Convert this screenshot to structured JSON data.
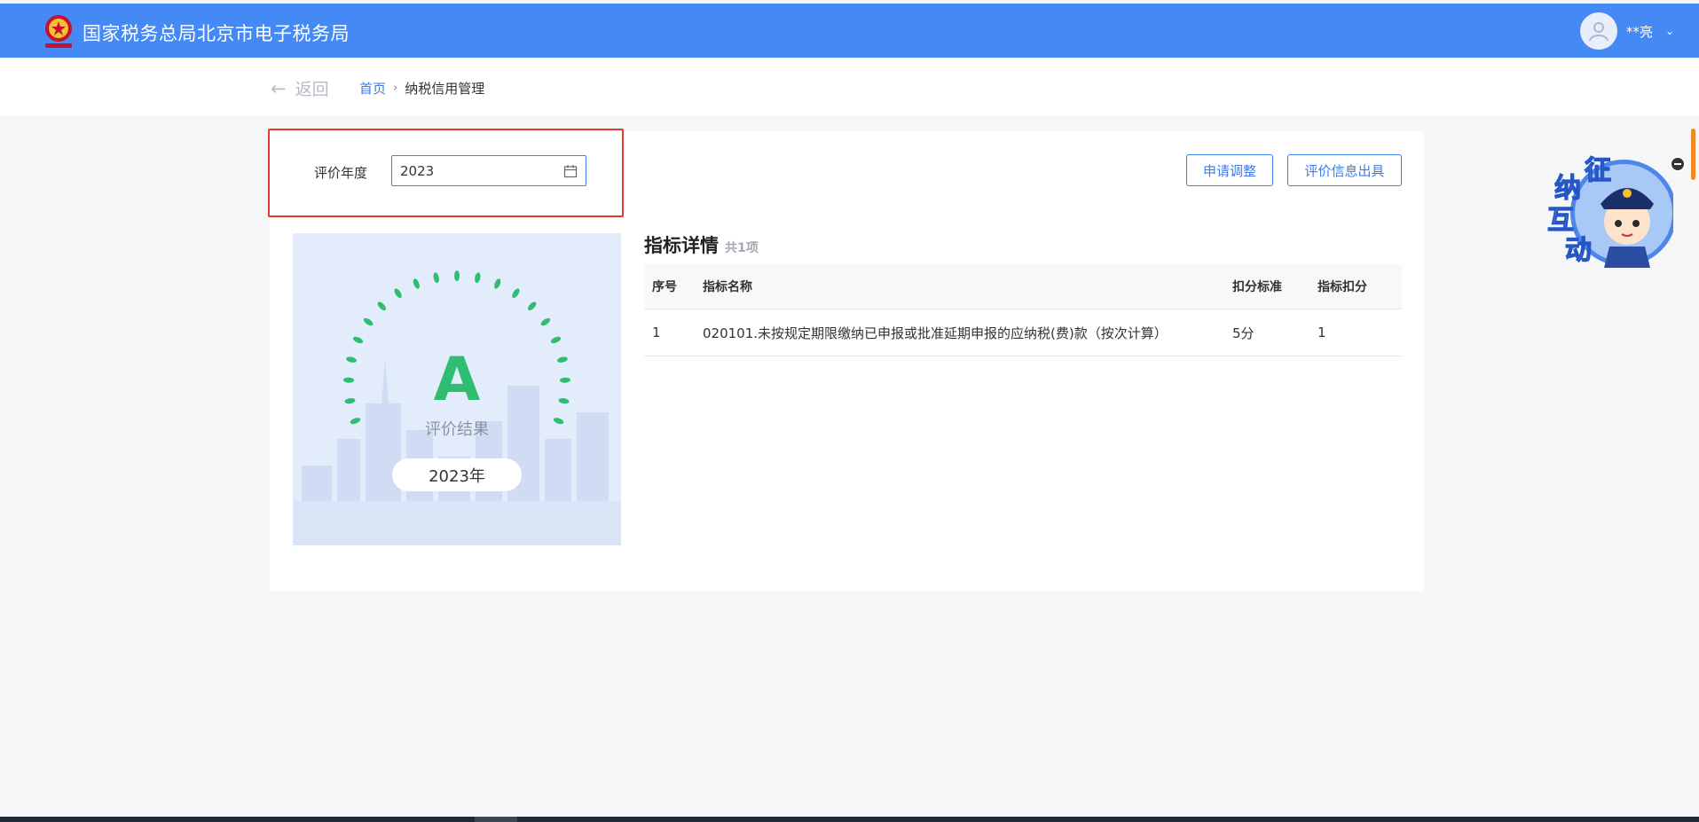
{
  "header": {
    "site_title": "国家税务总局北京市电子税务局",
    "user_name": "**亮",
    "emblem_icon": "tax-emblem-icon",
    "avatar_icon": "user-avatar-icon",
    "chevron_icon": "chevron-down-icon",
    "bar_color": "#4589f5"
  },
  "nav": {
    "back_label": "返回",
    "breadcrumb": {
      "home": "首页",
      "separator": "›",
      "current": "纳税信用管理"
    }
  },
  "filter": {
    "year_label": "评价年度",
    "year_value": "2023",
    "calendar_icon": "calendar-icon"
  },
  "actions": {
    "adjust_label": "申请调整",
    "export_label": "评价信息出具"
  },
  "grade": {
    "letter": "A",
    "subtitle": "评价结果",
    "year": "2023年",
    "grade_color": "#2fbd72"
  },
  "details": {
    "title": "指标详情",
    "count": "共1项",
    "columns": [
      "序号",
      "指标名称",
      "扣分标准",
      "指标扣分"
    ],
    "rows": [
      [
        "1",
        "020101.未按规定期限缴纳已申报或批准延期申报的应纳税(费)款（按次计算）",
        "5分",
        "1"
      ]
    ]
  },
  "widget": {
    "mascot_text": [
      "征",
      "纳",
      "互",
      "动"
    ],
    "close_icon": "minus-circle-icon"
  },
  "colors": {
    "accent": "#3f7de8",
    "highlight_border": "#e53935",
    "page_bg": "#f5f6f8"
  }
}
